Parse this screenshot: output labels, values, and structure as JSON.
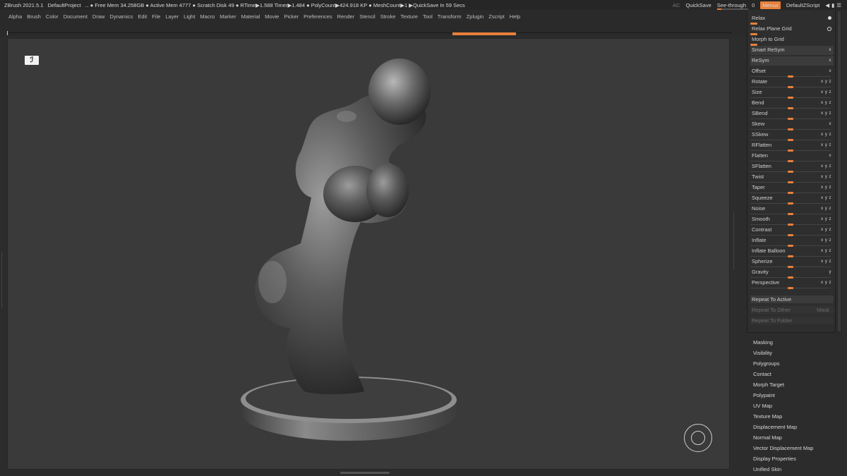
{
  "titlebar": {
    "app": "ZBrush 2021.5.1",
    "project": "DefaultProject",
    "stats": "‥ ● Free Mem 34.258GB ● Active Mem 4777 ● Scratch Disk 49 ●  RTime▶1.588 Timer▶1.484 ● PolyCount▶424.918 KP  ● MeshCount▶1  ▶QuickSave In 59 Secs",
    "ac": "AC",
    "quicksave": "QuickSave",
    "see_through_label": "See-through",
    "see_through_value": "0",
    "see_through_level": 0,
    "menus_label": "Menus",
    "zscript": "DefaultZScript",
    "icons": [
      "panel-left-icon",
      "panel-right-icon",
      "panel-toggle-icon"
    ]
  },
  "menubar": {
    "items": [
      "Alpha",
      "Brush",
      "Color",
      "Document",
      "Draw",
      "Dynamics",
      "Edit",
      "File",
      "Layer",
      "Light",
      "Macro",
      "Marker",
      "Material",
      "Movie",
      "Picker",
      "Preferences",
      "Render",
      "Stencil",
      "Stroke",
      "Texture",
      "Tool",
      "Transform",
      "Zplugin",
      "Zscript",
      "Help"
    ]
  },
  "viewport": {
    "logo_glyph": "ℐ",
    "model": "sculpted-figure-on-base",
    "navigation_gizmo": "rotate-gizmo-icon"
  },
  "deformation": {
    "top_buttons": [
      {
        "label": "Relax",
        "control": "dot"
      },
      {
        "label": "Relax Plane Grid",
        "control": "ring"
      },
      {
        "label": "Morph to Grid",
        "control": "none"
      },
      {
        "label": "Smart ReSym",
        "control": "ax"
      },
      {
        "label": "ReSym",
        "control": "ax"
      }
    ],
    "sliders": [
      {
        "label": "Offset",
        "axes": "x",
        "value": 0.5
      },
      {
        "label": "Rotate",
        "axes": "x y z",
        "value": 0.5
      },
      {
        "label": "Size",
        "axes": "x y z",
        "value": 0.5
      },
      {
        "label": "Bend",
        "axes": "x y z",
        "value": 0.5
      },
      {
        "label": "SBend",
        "axes": "x y z",
        "value": 0.5
      },
      {
        "label": "Skew",
        "axes": "x",
        "value": 0.5
      },
      {
        "label": "SSkew",
        "axes": "x y z",
        "value": 0.5
      },
      {
        "label": "RFlatten",
        "axes": "x y z",
        "value": 0.5
      },
      {
        "label": "Flatten",
        "axes": "x",
        "value": 0.5
      },
      {
        "label": "SFlatten",
        "axes": "x y z",
        "value": 0.5
      },
      {
        "label": "Twist",
        "axes": "x y z",
        "value": 0.5
      },
      {
        "label": "Taper",
        "axes": "x y z",
        "value": 0.5
      },
      {
        "label": "Squeeze",
        "axes": "x y z",
        "value": 0.5
      },
      {
        "label": "Noise",
        "axes": "x y z",
        "value": 0.5
      },
      {
        "label": "Smooth",
        "axes": "x y z",
        "value": 0.5
      },
      {
        "label": "Contrast",
        "axes": "x y z",
        "value": 0.5
      },
      {
        "label": "Inflate",
        "axes": "x y z",
        "value": 0.5
      },
      {
        "label": "Inflate Balloon",
        "axes": "x y z",
        "value": 0.5
      },
      {
        "label": "Spherize",
        "axes": "x y z",
        "value": 0.5
      },
      {
        "label": "Gravity",
        "axes": "y",
        "value": 0.5
      },
      {
        "label": "Perspective",
        "axes": "x y z",
        "value": 0.5
      }
    ],
    "repeat_to_active": "Repeat To Active",
    "repeat_to_other": "Repeat To Other",
    "mask": "Mask",
    "repeat_to_folder": "Repeat To Folder"
  },
  "subpalettes": [
    "Masking",
    "Visibility",
    "Polygroups",
    "Contact",
    "Morph Target",
    "Polypaint",
    "UV Map",
    "Texture Map",
    "Displacement Map",
    "Normal Map",
    "Vector Displacement Map",
    "Display Properties",
    "Unified Skin"
  ]
}
